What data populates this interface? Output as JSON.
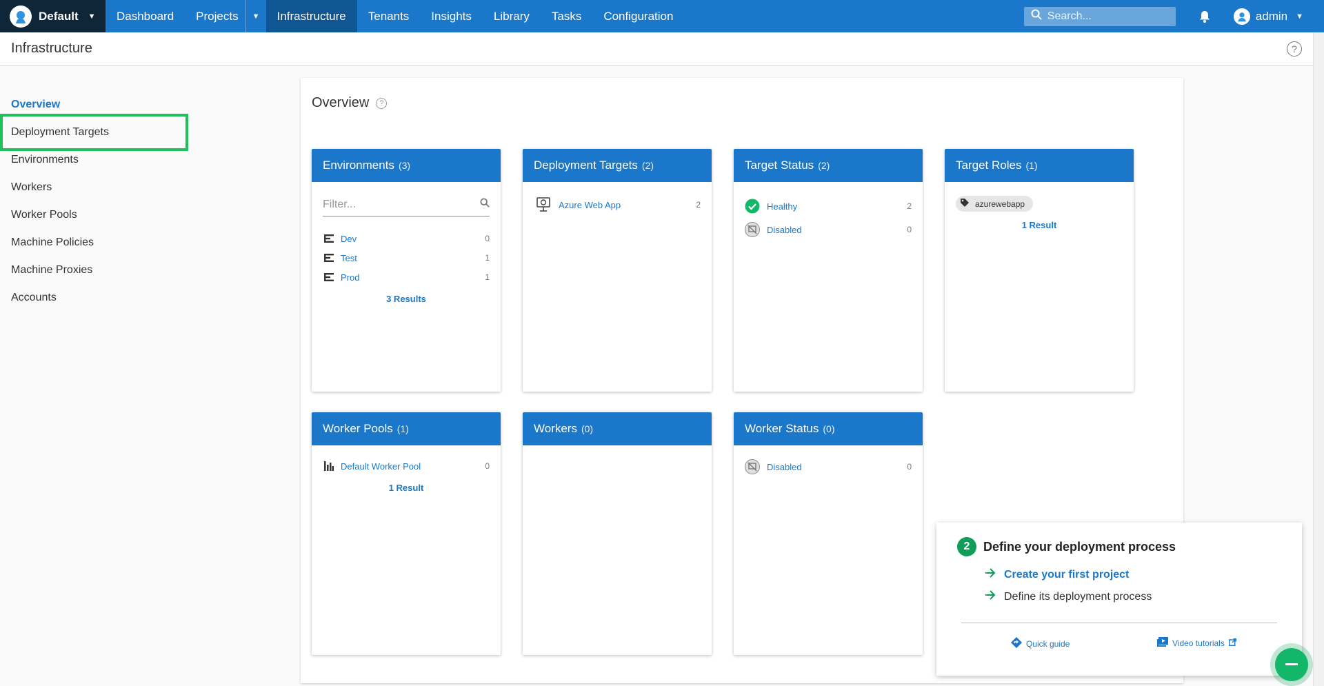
{
  "topnav": {
    "space": "Default",
    "items": [
      {
        "label": "Dashboard"
      },
      {
        "label": "Projects"
      },
      {
        "label": "Infrastructure"
      },
      {
        "label": "Tenants"
      },
      {
        "label": "Insights"
      },
      {
        "label": "Library"
      },
      {
        "label": "Tasks"
      },
      {
        "label": "Configuration"
      }
    ],
    "active": "Infrastructure",
    "search_placeholder": "Search...",
    "user": "admin"
  },
  "page": {
    "title": "Infrastructure"
  },
  "sidebar": {
    "items": [
      {
        "label": "Overview"
      },
      {
        "label": "Deployment Targets"
      },
      {
        "label": "Environments"
      },
      {
        "label": "Workers"
      },
      {
        "label": "Worker Pools"
      },
      {
        "label": "Machine Policies"
      },
      {
        "label": "Machine Proxies"
      },
      {
        "label": "Accounts"
      }
    ],
    "active": "Overview",
    "highlighted": "Deployment Targets"
  },
  "overview": {
    "heading": "Overview",
    "cards": {
      "environments": {
        "title": "Environments",
        "count": "(3)",
        "filter_placeholder": "Filter...",
        "rows": [
          {
            "label": "Dev",
            "value": "0"
          },
          {
            "label": "Test",
            "value": "1"
          },
          {
            "label": "Prod",
            "value": "1"
          }
        ],
        "results": "3 Results"
      },
      "deployment_targets": {
        "title": "Deployment Targets",
        "count": "(2)",
        "rows": [
          {
            "label": "Azure Web App",
            "value": "2"
          }
        ]
      },
      "target_status": {
        "title": "Target Status",
        "count": "(2)",
        "rows": [
          {
            "label": "Healthy",
            "value": "2"
          },
          {
            "label": "Disabled",
            "value": "0"
          }
        ]
      },
      "target_roles": {
        "title": "Target Roles",
        "count": "(1)",
        "tag": "azurewebapp",
        "results": "1 Result"
      },
      "worker_pools": {
        "title": "Worker Pools",
        "count": "(1)",
        "rows": [
          {
            "label": "Default Worker Pool",
            "value": "0"
          }
        ],
        "results": "1 Result"
      },
      "workers": {
        "title": "Workers",
        "count": "(0)"
      },
      "worker_status": {
        "title": "Worker Status",
        "count": "(0)",
        "rows": [
          {
            "label": "Disabled",
            "value": "0"
          }
        ]
      }
    }
  },
  "onboarding": {
    "step_number": "2",
    "title": "Define your deployment process",
    "steps": [
      {
        "label": "Create your first project"
      },
      {
        "label": "Define its deployment process"
      }
    ],
    "quick_guide": "Quick guide",
    "video_tutorials": "Video tutorials"
  },
  "colors": {
    "primary": "#1a77ca",
    "nav_dark": "#0f2538",
    "success": "#0f9d58",
    "highlight": "#1ec15a"
  }
}
